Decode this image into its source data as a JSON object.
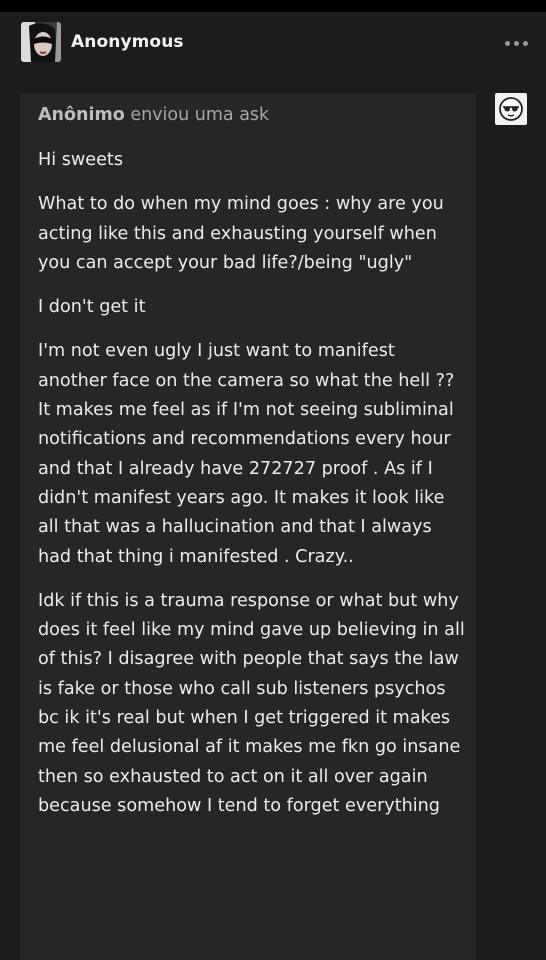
{
  "post": {
    "author": "Anonymous",
    "more_icon": "more-horizontal-icon",
    "avatar_icon": "avatar-image"
  },
  "ask": {
    "asker_name": "Anônimo",
    "asker_action": "enviou uma ask",
    "asker_avatar_icon": "anonymous-sunglasses-face-icon",
    "paragraphs": [
      "Hi sweets",
      "What to do when my mind goes : why are you acting like this and exhausting yourself when you can accept your bad life?/being \"ugly\"",
      "I don't get it",
      "I'm not even ugly I just want to manifest another face on the camera so what the hell ?? It makes me feel as if I'm not seeing subliminal notifications and recommendations every hour and that I already have 272727 proof .  As if I didn't manifest years ago. It makes it look like all that was a hallucination and that I always had that thing i manifested . Crazy..",
      "Idk if this is a trauma response or what but why does it feel like my mind gave up believing in all of this? I disagree with people that says the law is fake or those who call sub listeners psychos bc ik it's real but when I get triggered it makes me feel delusional af it makes me fkn go insane then so exhausted to act on it all over again because somehow I tend to forget everything"
    ]
  },
  "colors": {
    "background": "#1c1c1c",
    "ask_box": "#262626",
    "text": "#ececec",
    "muted_text": "#a6a6a6"
  }
}
